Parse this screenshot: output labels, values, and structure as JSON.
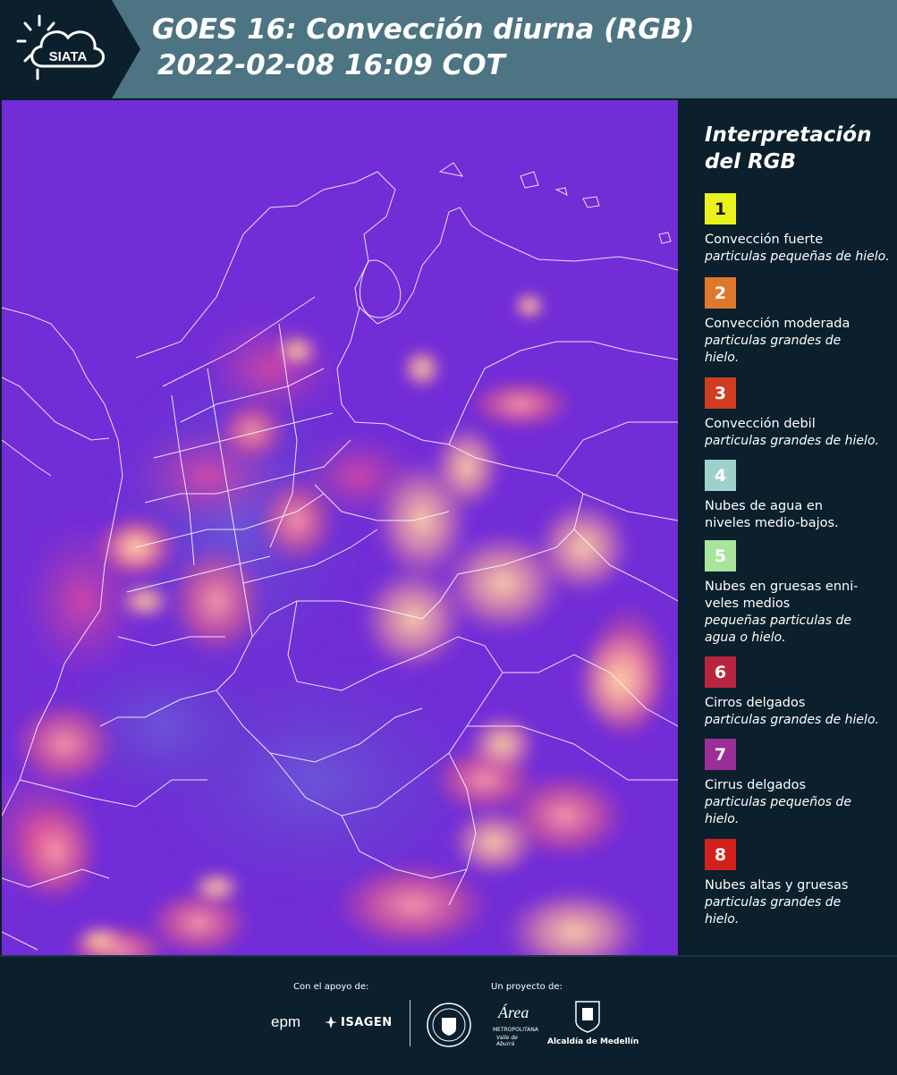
{
  "header": {
    "logo_text": "SIATA",
    "title": "GOES 16: Convección diurna (RGB)",
    "datetime": "2022-02-08 16:09 COT"
  },
  "colors": {
    "header_bg": "#4d7482",
    "dark_bg": "#0b1f2c",
    "map_base": "#6f2fd8",
    "border_lines": "#ffffff"
  },
  "legend": {
    "title": "Interpretación\ndel RGB",
    "items": [
      {
        "num": "1",
        "color": "#e9f21b",
        "text_color": "#1a1a1a",
        "main": "Convección fuerte",
        "sub": "particulas pequeñas de hielo."
      },
      {
        "num": "2",
        "color": "#e0782b",
        "text_color": "#ffffff",
        "main": "Convección moderada",
        "sub": "particulas grandes de\nhielo."
      },
      {
        "num": "3",
        "color": "#d03d21",
        "text_color": "#ffffff",
        "main": "Convección debil",
        "sub": "particulas grandes de hielo."
      },
      {
        "num": "4",
        "color": "#9fd0cc",
        "text_color": "#ffffff",
        "main": "Nubes de agua en\nniveles medio-bajos.",
        "sub": ""
      },
      {
        "num": "5",
        "color": "#a8e59a",
        "text_color": "#ffffff",
        "main": "Nubes en gruesas enni-\nveles medios",
        "sub": "pequeñas particulas de\nagua o hielo."
      },
      {
        "num": "6",
        "color": "#b8253f",
        "text_color": "#ffffff",
        "main": "Cirros delgados",
        "sub": "particulas grandes de hielo."
      },
      {
        "num": "7",
        "color": "#9c2e9a",
        "text_color": "#ffffff",
        "main": "Cirrus delgados",
        "sub": "particulas pequeños de\nhielo."
      },
      {
        "num": "8",
        "color": "#d2201c",
        "text_color": "#ffffff",
        "main": "Nubes altas y gruesas",
        "sub": "particulas grandes de\nhielo."
      }
    ]
  },
  "footer": {
    "support_label": "Con el apoyo de:",
    "project_label": "Un proyecto de:",
    "epm": "epm",
    "isagen": "ISAGEN",
    "area_script": "Área",
    "area_line1": "METROPOLITANA",
    "area_line2": "Valle de Aburrá",
    "alcaldia": "Alcaldía de Medellín"
  }
}
